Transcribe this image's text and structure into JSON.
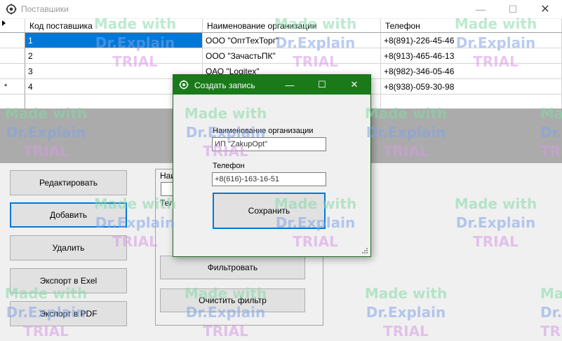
{
  "main_window": {
    "title": "Поставшики",
    "controls": {
      "minimize": "—",
      "maximize": "☐",
      "close": "✕"
    }
  },
  "grid": {
    "columns": [
      "Код поставшика",
      "Наименование организации",
      "Телефон"
    ],
    "rows": [
      {
        "code": "1",
        "name": "ООО \"ОптТехТорг\"",
        "phone": "+8(891)-226-45-46"
      },
      {
        "code": "2",
        "name": "ООО \"ЗачастьПК\"",
        "phone": "+8(913)-465-46-13"
      },
      {
        "code": "3",
        "name": "ОАО \"Logitex\"",
        "phone": "+8(982)-346-05-46"
      },
      {
        "code": "4",
        "name": "",
        "phone": "+8(938)-059-30-98"
      }
    ],
    "new_row_marker": "*",
    "selected_color": "#0078d7"
  },
  "actions": {
    "edit": "Редактировать",
    "add": "Добавить",
    "delete": "Удалить",
    "export_excel": "Экспорт в Exel",
    "export_pdf": "Экспорт в PDF"
  },
  "filter": {
    "name_label": "Наи",
    "phone_label": "Теле",
    "apply": "Фильтровать",
    "clear": "Очистить фильтр"
  },
  "dialog": {
    "title": "Создать запись",
    "controls": {
      "minimize": "—",
      "maximize": "☐",
      "close": "✕"
    },
    "org_label": "Наименование организации",
    "org_value": "ИП \"ZakupOpt\"",
    "phone_label": "Телефон",
    "phone_value": "+8(616)-163-16-51",
    "save": "Сохранить",
    "titlebar_color": "#1a7a1a"
  },
  "watermark": {
    "line1": "Made with",
    "line2": "Dr.Explain",
    "line3": "TRIAL"
  }
}
